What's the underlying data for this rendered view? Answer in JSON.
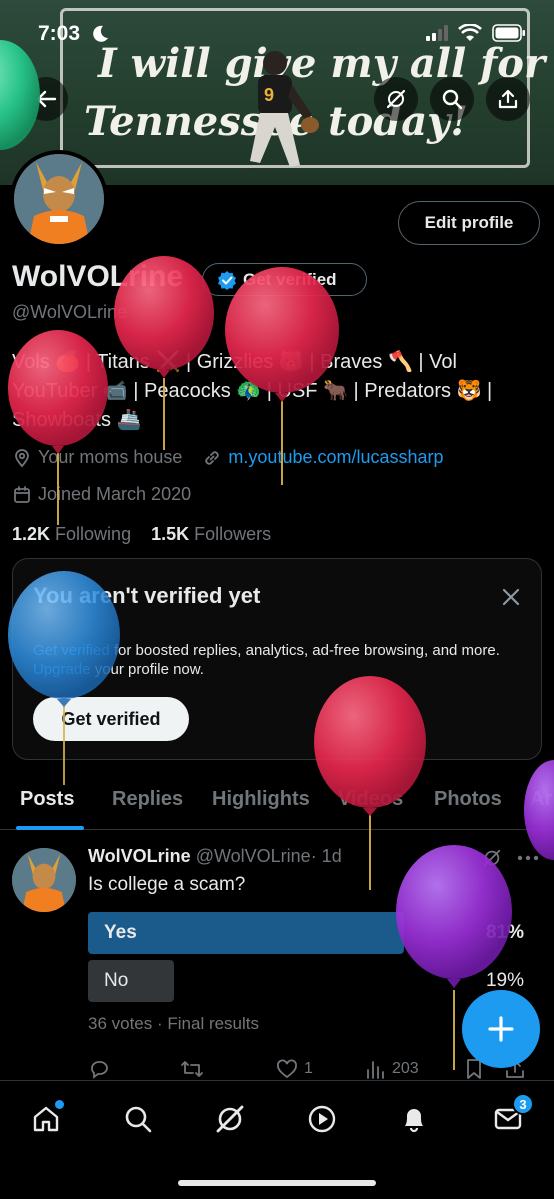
{
  "status_bar": {
    "time": "7:03"
  },
  "banner": {
    "line1": "I will give my all for",
    "line2": "Tennessee today!"
  },
  "profile": {
    "name": "WolVOLrine",
    "handle": "@WolVOLrine",
    "get_verified_chip": "Get verified",
    "edit_profile": "Edit profile",
    "bio_lines": [
      "Vols 🍊 | Titans ⚔️ | Grizzlies 🐻 | Braves 🪓 | Vol",
      "YouTuber 📹 | Peacocks 🦚 | USF 🐂 | Predators 🐯 |",
      "Showboats 🚢"
    ],
    "location": "Your moms house",
    "website": "m.youtube.com/lucassharp",
    "joined": "Joined March 2020",
    "following_count": "1.2K",
    "following_label": "Following",
    "followers_count": "1.5K",
    "followers_label": "Followers"
  },
  "verify_card": {
    "title": "You aren't verified yet",
    "text_link1": "Get verified",
    "text_part1": " for boosted replies, analytics, ad-free browsing, and more.",
    "text_link2": "Upgrade",
    "text_part2": " your profile now.",
    "button": "Get verified"
  },
  "tabs": [
    "Posts",
    "Replies",
    "Highlights",
    "Videos",
    "Photos",
    "Ar"
  ],
  "post": {
    "author": "WolVOLrine",
    "handle": "@WolVOLrine",
    "time": "· 1d",
    "text": "Is college a scam?",
    "poll": [
      {
        "label": "Yes",
        "percent": "81%",
        "fraction": 0.81,
        "winner": true
      },
      {
        "label": "No",
        "percent": "19%",
        "fraction": 0.19,
        "winner": false
      }
    ],
    "votes": "36 votes · Final results",
    "likes": "1",
    "views": "203"
  },
  "nav": {
    "messages_badge": "3"
  },
  "colors": {
    "accent": "#1d9bf0",
    "background": "#000000",
    "muted": "#71767b",
    "poll_winner": "#1a5b8c",
    "poll_other": "#333639"
  }
}
